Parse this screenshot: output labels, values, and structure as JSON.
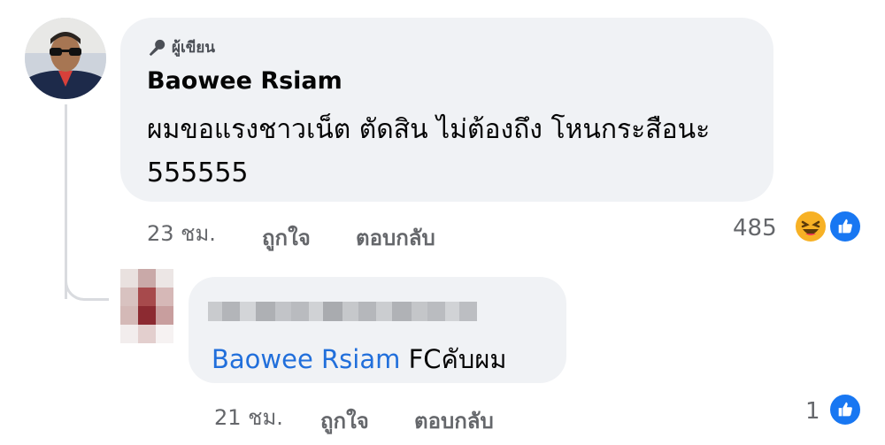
{
  "main_comment": {
    "author_badge": "ผู้เขียน",
    "author_name": "Baowee Rsiam",
    "text": "ผมขอแรงชาวเน็ต ตัดสิน ไม่ต้องถึง โหนกระสือนะ 555555",
    "time": "23 ชม.",
    "like_label": "ถูกใจ",
    "reply_label": "ตอบกลับ",
    "reaction_count": "485",
    "reactions": [
      "haha-icon",
      "like-icon"
    ]
  },
  "reply_comment": {
    "author_name_blurred": true,
    "mention": "Baowee Rsiam",
    "text": "FCคับผม",
    "time": "21 ชม.",
    "like_label": "ถูกใจ",
    "reply_label": "ตอบกลับ",
    "reaction_count": "1",
    "reactions": [
      "like-icon"
    ]
  },
  "colors": {
    "bubble": "#f0f2f5",
    "mention": "#216fdb",
    "meta_text": "#65676b",
    "like": "#1877f2",
    "haha": "#f7b125"
  }
}
